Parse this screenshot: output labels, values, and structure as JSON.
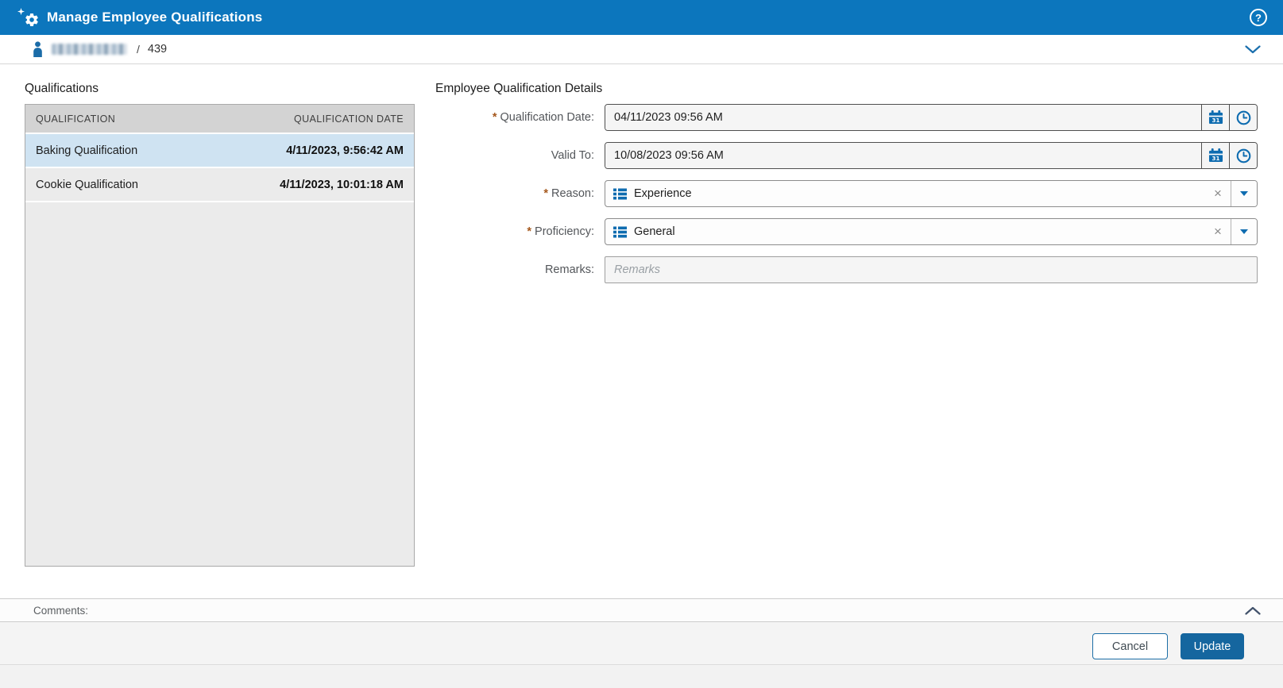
{
  "header": {
    "title": "Manage Employee Qualifications"
  },
  "subheader": {
    "separator": "/",
    "employee_id": "439"
  },
  "qualifications": {
    "title": "Qualifications",
    "table": {
      "columns": [
        "QUALIFICATION",
        "QUALIFICATION DATE"
      ],
      "rows": [
        {
          "name": "Baking Qualification",
          "date": "4/11/2023, 9:56:42 AM",
          "selected": true
        },
        {
          "name": "Cookie Qualification",
          "date": "4/11/2023, 10:01:18 AM",
          "selected": false
        }
      ]
    }
  },
  "details": {
    "title": "Employee Qualification Details",
    "required_marker": "*",
    "fields": {
      "qualification_date": {
        "label": "Qualification Date:",
        "required": true,
        "value": "04/11/2023 09:56 AM"
      },
      "valid_to": {
        "label": "Valid To:",
        "required": false,
        "value": "10/08/2023 09:56 AM"
      },
      "reason": {
        "label": "Reason:",
        "required": true,
        "value": "Experience"
      },
      "proficiency": {
        "label": "Proficiency:",
        "required": true,
        "value": "General"
      },
      "remarks": {
        "label": "Remarks:",
        "required": false,
        "value": "",
        "placeholder": "Remarks"
      }
    }
  },
  "comments": {
    "label": "Comments:"
  },
  "footer": {
    "cancel_label": "Cancel",
    "update_label": "Update"
  },
  "glyphs": {
    "help": "?",
    "clear": "×",
    "calendar_day": "31"
  },
  "colors": {
    "header_blue": "#0c76bd",
    "accent_blue": "#0e6cb0",
    "icon_person_blue": "#1b6ca8",
    "selected_row": "#cfe3f2",
    "table_header_gray": "#d3d3d3",
    "required_asterisk": "#a5581d",
    "update_button_blue": "#15669f"
  }
}
